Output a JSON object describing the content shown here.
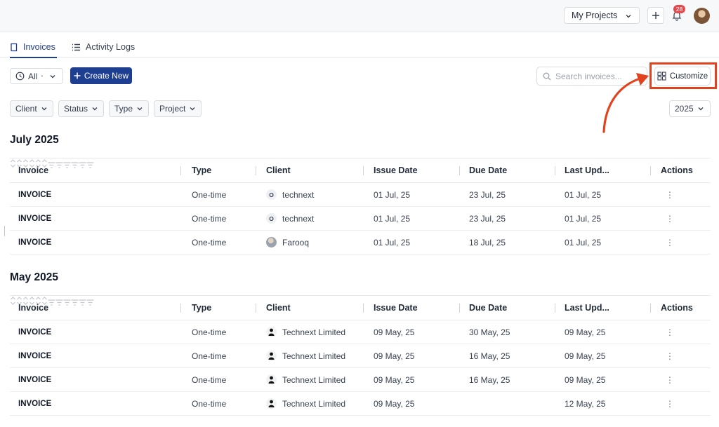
{
  "header": {
    "project_select": "My Projects",
    "notification_count": "28"
  },
  "tabs": [
    {
      "label": "Invoices",
      "icon": "book-icon",
      "active": true
    },
    {
      "label": "Activity Logs",
      "icon": "list-icon",
      "active": false
    }
  ],
  "toolbar": {
    "time_filter": "All",
    "create_label": "Create New",
    "search_placeholder": "Search invoices...",
    "customize_label": "Customize"
  },
  "filters": {
    "client": "Client",
    "status": "Status",
    "type": "Type",
    "project": "Project",
    "year": "2025"
  },
  "columns": [
    "Invoice",
    "Type",
    "Client",
    "Issue Date",
    "Due Date",
    "Last Upd...",
    "Actions"
  ],
  "groups": [
    {
      "title": "July 2025",
      "rows": [
        {
          "invoice": "INVOICE",
          "type": "One-time",
          "client": "technext",
          "avatar": "O",
          "avatar_kind": "letter",
          "issue": "01 Jul, 25",
          "due": "23 Jul, 25",
          "updated": "01 Jul, 25",
          "actions": "⋮"
        },
        {
          "invoice": "INVOICE",
          "type": "One-time",
          "client": "technext",
          "avatar": "O",
          "avatar_kind": "letter",
          "issue": "01 Jul, 25",
          "due": "23 Jul, 25",
          "updated": "01 Jul, 25",
          "actions": "⋮"
        },
        {
          "invoice": "INVOICE",
          "type": "One-time",
          "client": "Farooq",
          "avatar": "",
          "avatar_kind": "photo",
          "issue": "01 Jul, 25",
          "due": "18 Jul, 25",
          "updated": "01 Jul, 25",
          "actions": "⋮"
        }
      ]
    },
    {
      "title": "May 2025",
      "rows": [
        {
          "invoice": "INVOICE",
          "type": "One-time",
          "client": "Technext Limited",
          "avatar": "",
          "avatar_kind": "person",
          "issue": "09 May, 25",
          "due": "30 May, 25",
          "updated": "09 May, 25",
          "actions": "⋮"
        },
        {
          "invoice": "INVOICE",
          "type": "One-time",
          "client": "Technext Limited",
          "avatar": "",
          "avatar_kind": "person",
          "issue": "09 May, 25",
          "due": "16 May, 25",
          "updated": "09 May, 25",
          "actions": "⋮"
        },
        {
          "invoice": "INVOICE",
          "type": "One-time",
          "client": "Technext Limited",
          "avatar": "",
          "avatar_kind": "person",
          "issue": "09 May, 25",
          "due": "16 May, 25",
          "updated": "09 May, 25",
          "actions": "⋮"
        },
        {
          "invoice": "INVOICE",
          "type": "One-time",
          "client": "Technext Limited",
          "avatar": "",
          "avatar_kind": "person",
          "issue": "09 May, 25",
          "due": "",
          "updated": "12 May, 25",
          "actions": "⋮"
        }
      ]
    }
  ],
  "colors": {
    "primary": "#1e3f91",
    "highlight": "#e2431f",
    "badge": "#e5484d"
  }
}
